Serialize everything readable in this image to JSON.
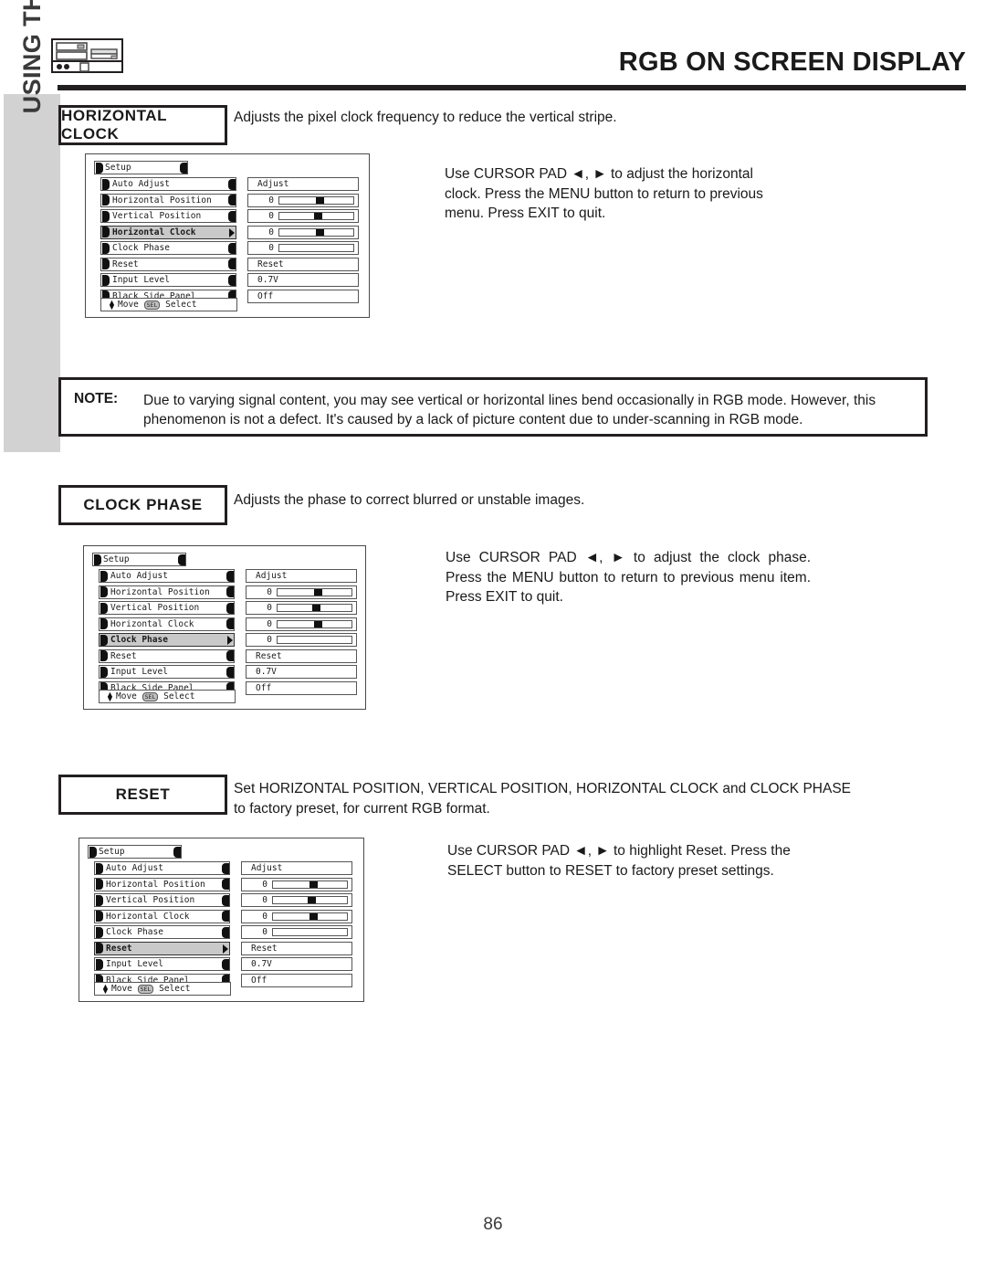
{
  "header": {
    "title": "RGB ON SCREEN DISPLAY",
    "device_icon": "tv-front-panel-icon"
  },
  "sidebar": {
    "label": "USING THE RGB INPUT"
  },
  "page_number": "86",
  "sections": [
    {
      "id": "horizontal-clock",
      "heading": "HORIZONTAL CLOCK",
      "description": "Adjusts the pixel clock frequency to reduce the vertical stripe.",
      "instructions": "Use CURSOR PAD ◄, ► to adjust the horizontal clock.  Press the MENU button to return to previous menu.  Press EXIT to quit."
    },
    {
      "id": "clock-phase",
      "heading": "CLOCK PHASE",
      "description": "Adjusts the phase to correct blurred or unstable images.",
      "instructions": "Use CURSOR PAD ◄, ► to adjust the clock phase. Press the MENU button to return to previous menu item. Press EXIT to quit."
    },
    {
      "id": "reset",
      "heading": "RESET",
      "description": "Set HORIZONTAL POSITION, VERTICAL POSITION, HORIZONTAL CLOCK   and CLOCK PHASE to factory preset, for current RGB format.",
      "instructions": "Use CURSOR PAD ◄, ► to highlight Reset. Press the SELECT button to RESET to factory preset settings."
    }
  ],
  "note": {
    "label": "NOTE:",
    "text": "Due to varying signal content, you may see vertical or horizontal lines bend occasionally in RGB mode.  However, this phenomenon is not a defect.  It's caused by a lack of picture content due to under-scanning in RGB mode."
  },
  "osd": {
    "title": "Setup",
    "footer": {
      "move_label": "Move",
      "sel_key": "SEL",
      "select_label": "Select"
    },
    "rows": [
      {
        "label": "Auto Adjust",
        "value_type": "text",
        "value": "Adjust"
      },
      {
        "label": "Horizontal Position",
        "value_type": "slider",
        "value": "0",
        "thumb_pct": 54
      },
      {
        "label": "Vertical Position",
        "value_type": "slider",
        "value": "0",
        "thumb_pct": 52
      },
      {
        "label": "Horizontal Clock",
        "value_type": "slider",
        "value": "0",
        "thumb_pct": 54
      },
      {
        "label": "Clock Phase",
        "value_type": "slider",
        "value": "0",
        "thumb_pct": -1
      },
      {
        "label": "Reset",
        "value_type": "text",
        "value": "Reset"
      },
      {
        "label": "Input Level",
        "value_type": "text",
        "value": "0.7V"
      },
      {
        "label": "Black Side Panel",
        "value_type": "text",
        "value": "Off"
      }
    ],
    "menus": [
      {
        "id": "osd-horizontal-clock",
        "selected_index": 3
      },
      {
        "id": "osd-clock-phase",
        "selected_index": 4
      },
      {
        "id": "osd-reset",
        "selected_index": 5
      }
    ]
  },
  "colors": {
    "rule": "#231f20",
    "sidebar_band": "#d2d2d2",
    "highlight_row": "#c9c9c9",
    "text": "#1a1a1a"
  }
}
